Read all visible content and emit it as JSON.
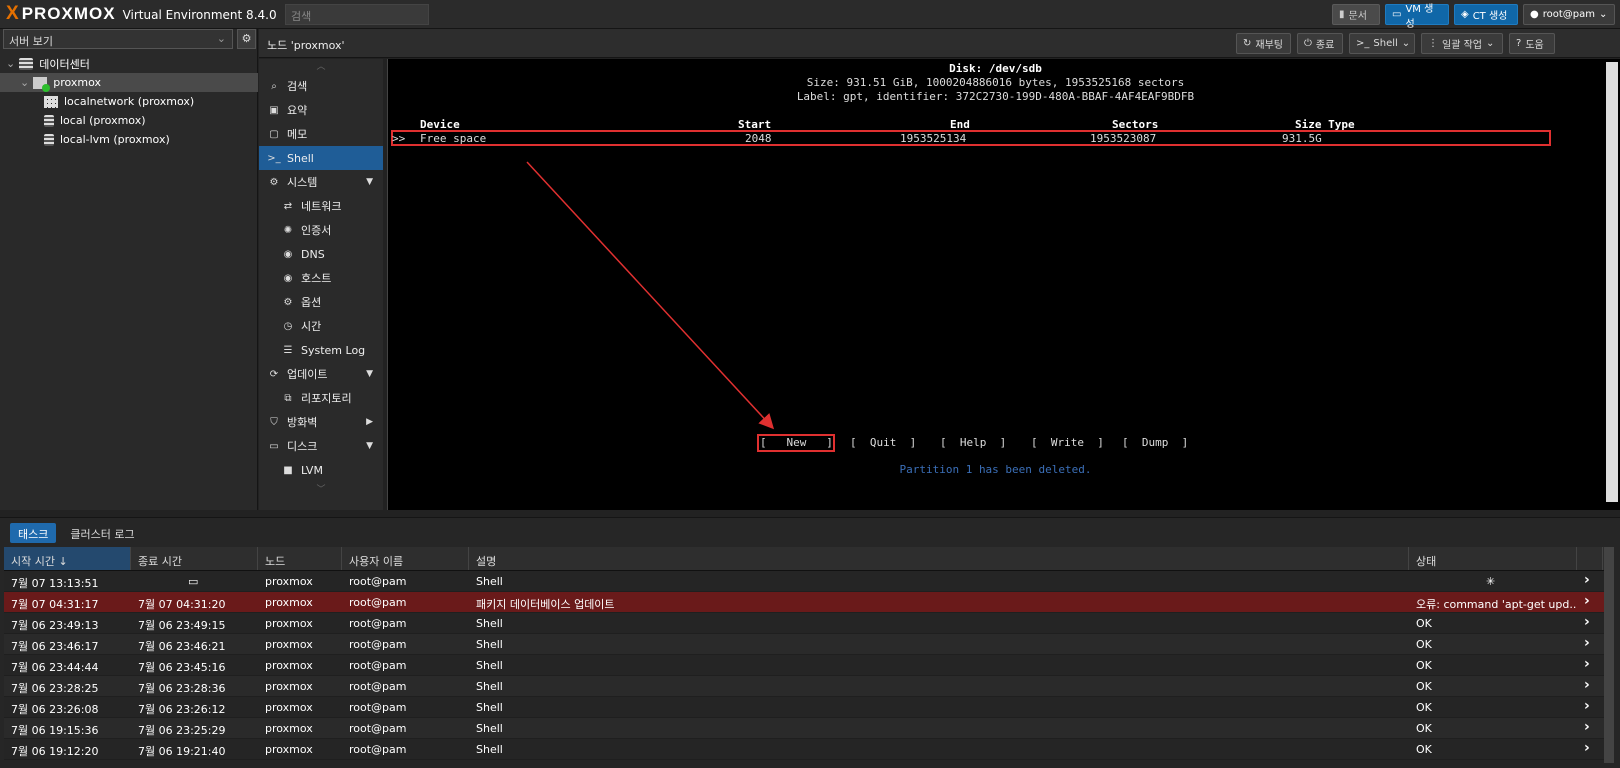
{
  "app": {
    "logo_text": "PROXMOX",
    "logo_x": "X",
    "version_label": "Virtual Environment 8.4.0",
    "search_placeholder": "검색"
  },
  "topbar": {
    "docs": "문서",
    "create_vm": "VM 생성",
    "create_ct": "CT 생성",
    "user": "root@pam"
  },
  "sidebar": {
    "view": "서버 보기",
    "datacenter": "데이터센터",
    "node": "proxmox",
    "items": [
      "localnetwork (proxmox)",
      "local (proxmox)",
      "local-lvm (proxmox)"
    ]
  },
  "main": {
    "title": "노드 'proxmox'",
    "reboot": "재부팅",
    "shutdown": "종료",
    "shell": "Shell",
    "bulk": "일괄 작업",
    "help": "도움"
  },
  "nav": {
    "search": "검색",
    "summary": "요약",
    "notes": "메모",
    "shell": "Shell",
    "system": "시스템",
    "network": "네트워크",
    "certs": "인증서",
    "dns": "DNS",
    "hosts": "호스트",
    "options": "옵션",
    "time": "시간",
    "syslog": "System Log",
    "updates": "업데이트",
    "repos": "리포지토리",
    "firewall": "방화벽",
    "disks": "디스크",
    "lvm": "LVM"
  },
  "terminal": {
    "disk": "Disk: /dev/sdb",
    "size": "Size: 931.51 GiB, 1000204886016 bytes, 1953525168 sectors",
    "label": "Label: gpt, identifier: 372C2730-199D-480A-BBAF-4AF4EAF9BDFB",
    "h_device": "Device",
    "h_start": "Start",
    "h_end": "End",
    "h_sectors": "Sectors",
    "h_sizetype": "Size Type",
    "r_marker": ">>",
    "r_device": "Free space",
    "r_start": "2048",
    "r_end": "1953525134",
    "r_sectors": "1953523087",
    "r_size": "931.5G",
    "menu": [
      "[   New   ]",
      "[  Quit  ]",
      "[  Help  ]",
      "[  Write  ]",
      "[  Dump  ]"
    ],
    "status": "Partition 1 has been deleted."
  },
  "bottom": {
    "tab_tasks": "태스크",
    "tab_cluster": "클러스터 로그",
    "headers": [
      "시작 시간 ↓",
      "종료 시간",
      "노드",
      "사용자 이름",
      "설명",
      "상태"
    ],
    "rows": [
      [
        "7월 07 13:13:51",
        "",
        "proxmox",
        "root@pam",
        "Shell",
        ""
      ],
      [
        "7월 07 04:31:17",
        "7월 07 04:31:20",
        "proxmox",
        "root@pam",
        "패키지 데이터베이스 업데이트",
        "오류: command 'apt-get upd..."
      ],
      [
        "7월 06 23:49:13",
        "7월 06 23:49:15",
        "proxmox",
        "root@pam",
        "Shell",
        "OK"
      ],
      [
        "7월 06 23:46:17",
        "7월 06 23:46:21",
        "proxmox",
        "root@pam",
        "Shell",
        "OK"
      ],
      [
        "7월 06 23:44:44",
        "7월 06 23:45:16",
        "proxmox",
        "root@pam",
        "Shell",
        "OK"
      ],
      [
        "7월 06 23:28:25",
        "7월 06 23:28:36",
        "proxmox",
        "root@pam",
        "Shell",
        "OK"
      ],
      [
        "7월 06 23:26:08",
        "7월 06 23:26:12",
        "proxmox",
        "root@pam",
        "Shell",
        "OK"
      ],
      [
        "7월 06 19:15:36",
        "7월 06 23:25:29",
        "proxmox",
        "root@pam",
        "Shell",
        "OK"
      ],
      [
        "7월 06 19:12:20",
        "7월 06 19:21:40",
        "proxmox",
        "root@pam",
        "Shell",
        "OK"
      ]
    ]
  },
  "colors": {
    "accent": "#1f6aad",
    "error_row": "#6a1a1a",
    "highlight": "#e03030",
    "logo": "#e57000"
  }
}
